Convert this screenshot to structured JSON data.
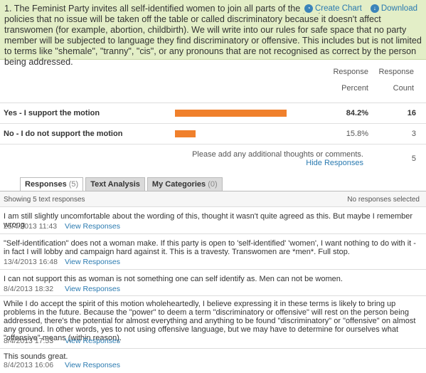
{
  "question": {
    "text": "1. The Feminist Party invites all self-identified women to join all parts of the party. We will write into our policies that no issue will be taken off the table or called discriminatory because it doesn't affect transwomen (for example, abortion, childbirth). We will write into our rules for safe space that no party member will be subjected to language they find discriminatory or offensive. This includes but is not limited to terms like \"shemale\", \"tranny\", \"cis\", or any pronouns that are not recognised as correct by the person being addressed.",
    "create_chart": "Create Chart",
    "download": "Download"
  },
  "results": {
    "col_percent_1": "Response",
    "col_percent_2": "Percent",
    "col_count_1": "Response",
    "col_count_2": "Count",
    "rows": [
      {
        "label": "Yes - I support the motion",
        "percent": "84.2%",
        "count": "16",
        "fraction": 0.842
      },
      {
        "label": "No - I do not support the motion",
        "percent": "15.8%",
        "count": "3",
        "fraction": 0.158
      }
    ],
    "additional_prompt": "Please add any additional thoughts or comments.",
    "hide_responses": "Hide Responses",
    "additional_count": "5"
  },
  "tabs": [
    {
      "label": "Responses",
      "count": "(5)"
    },
    {
      "label": "Text Analysis",
      "count": ""
    },
    {
      "label": "My Categories",
      "count": "(0)"
    }
  ],
  "panel": {
    "showing": "Showing 5 text responses",
    "selected": "No responses selected"
  },
  "view_label": "View Responses",
  "responses": [
    {
      "text": "I am still slightly uncomfortable about the wording of this, thought it wasn't quite agreed as this. But maybe I remember wrong",
      "date": "25/4/2013 11:43"
    },
    {
      "text": "\"Self-identification\" does not a woman make. If this party is open to 'self-identified' 'women', I want nothing to do with it - in fact I will lobby and campaign hard against it. This is a travesty. Transwomen are *men*. Full stop.",
      "date": "13/4/2013 16:48"
    },
    {
      "text": "I can not support this as woman is not something one can self identify as. Men can not be women.",
      "date": "8/4/2013 18:32"
    },
    {
      "text": "While I do accept the spirit of this motion wholeheartedly, I believe expressing it in these terms is likely to bring up problems in the future. Because the \"power\" to deem a term \"discriminatory or offensive\" will rest on the person being addressed, there's the potential for almost everything and anything to be found \"discriminatory\" or \"offensive\" on almost any ground. In other words, yes to not using offensive language, but we may have to determine for ourselves what \"offensive\" means (within reason).",
      "date": "8/4/2013 17:53"
    },
    {
      "text": "This sounds great.",
      "date": "8/4/2013 16:06"
    }
  ]
}
